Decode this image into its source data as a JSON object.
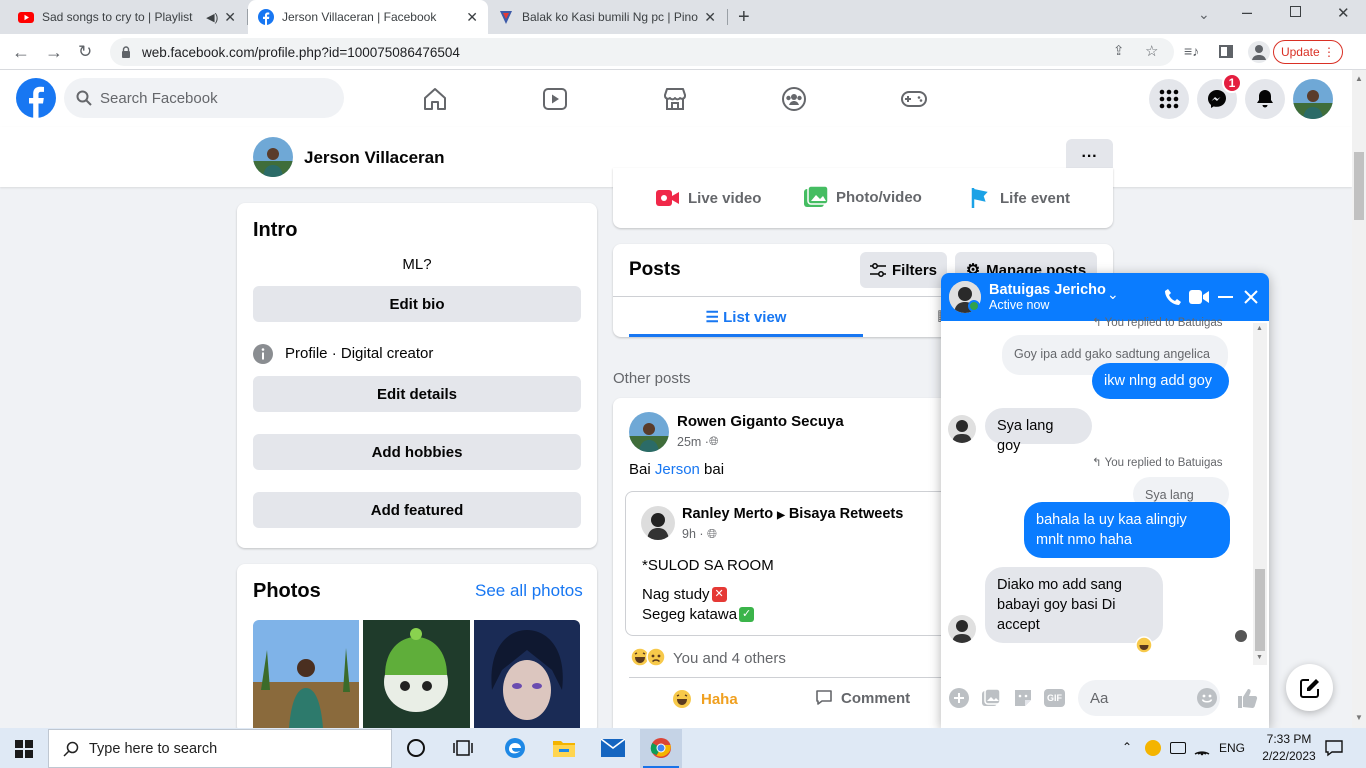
{
  "browser": {
    "tabs": [
      {
        "title": "Sad songs to cry to | Playlist",
        "icon": "youtube-icon"
      },
      {
        "title": "Jerson Villaceran | Facebook",
        "icon": "facebook-icon"
      },
      {
        "title": "Balak ko Kasi bumili Ng pc | Pinoy",
        "icon": "pinoy-icon"
      }
    ],
    "url": "web.facebook.com/profile.php?id=100075086476504",
    "update_label": "Update",
    "colors": {
      "tabbar": "#dee1e6",
      "update": "#d93025"
    }
  },
  "facebook": {
    "search_placeholder": "Search Facebook",
    "messenger_badge": "1",
    "brand_color": "#1877f2"
  },
  "profile": {
    "name": "Jerson Villaceran",
    "more_label": "···"
  },
  "intro": {
    "title": "Intro",
    "bio": "ML?",
    "edit_bio": "Edit bio",
    "profile_label": "Profile",
    "profile_detail": " · Digital creator",
    "edit_details": "Edit details",
    "add_hobbies": "Add hobbies",
    "add_featured": "Add featured"
  },
  "photos": {
    "title": "Photos",
    "see_all": "See all photos"
  },
  "composer": {
    "live_video": "Live video",
    "photo_video": "Photo/video",
    "life_event": "Life event"
  },
  "posts": {
    "title": "Posts",
    "filters": "Filters",
    "manage": "Manage posts",
    "list_view": "List view",
    "other_posts": "Other posts"
  },
  "post": {
    "author": "Rowen Giganto Secuya",
    "time": "25m · ",
    "text_prefix": "Bai ",
    "text_tag": "Jerson",
    "text_suffix": " bai",
    "shared_author": "Ranley Merto",
    "shared_group": "Bisaya Retweets",
    "shared_time": "9h · ",
    "shared_line1": "*SULOD SA ROOM",
    "shared_line2": "Nag study",
    "shared_line3": "Segeg katawa",
    "reactions": "You and 4 others",
    "haha": "Haha",
    "comment": "Comment"
  },
  "chat": {
    "name": "Batuigas Jericho",
    "status": "Active now",
    "messages": {
      "reply_top": "You replied to Batuigas",
      "quote1": "Goy ipa add gako sadtung angelica",
      "out1": "ikw nlng add goy",
      "in1": "Sya lang goy",
      "reply2": "You replied to Batuigas",
      "quote2": "Sya lang goy",
      "out2": "bahala la uy kaa alingiy mnlt nmo haha",
      "in2": "Diako mo add sang babayi goy basi Di accept"
    },
    "input_placeholder": "Aa"
  },
  "taskbar": {
    "search_placeholder": "Type here to search",
    "lang": "ENG",
    "time": "7:33 PM",
    "date": "2/22/2023"
  }
}
